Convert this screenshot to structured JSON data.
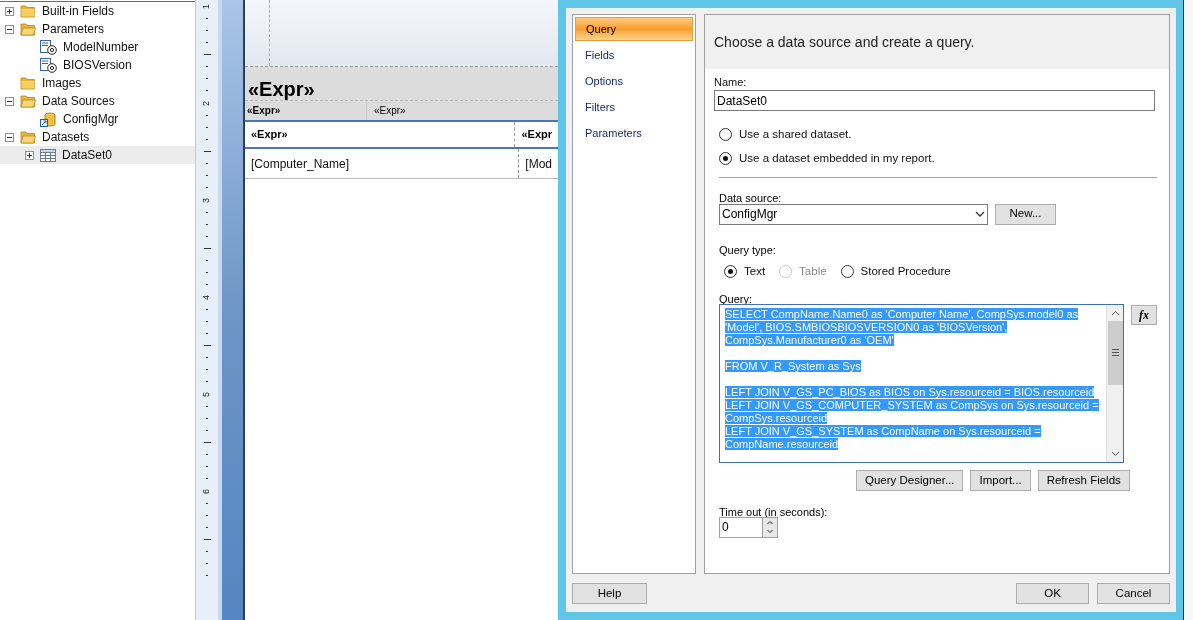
{
  "tree": [
    {
      "label": "Built-in Fields",
      "kind": "folder",
      "expanded": false,
      "selected": false
    },
    {
      "label": "Parameters",
      "kind": "folder",
      "expanded": true,
      "selected": false,
      "children": [
        {
          "label": "ModelNumber",
          "kind": "parameter",
          "selected": false
        },
        {
          "label": "BIOSVersion",
          "kind": "parameter",
          "selected": false
        }
      ]
    },
    {
      "label": "Images",
      "kind": "folder",
      "selected": false
    },
    {
      "label": "Data Sources",
      "kind": "folder",
      "expanded": true,
      "selected": false,
      "children": [
        {
          "label": "ConfigMgr",
          "kind": "data_source",
          "selected": false
        }
      ]
    },
    {
      "label": "Datasets",
      "kind": "folder",
      "expanded": true,
      "selected": false,
      "children": [
        {
          "label": "DataSet0",
          "kind": "dataset",
          "expanded": false,
          "selected": true
        }
      ]
    }
  ],
  "ruler": {
    "labels": [
      "1",
      "2",
      "3",
      "4",
      "5",
      "6"
    ]
  },
  "report": {
    "title": "«Expr»",
    "header_fields": [
      "«Expr»",
      "«Expr»"
    ],
    "columns": [
      "«Expr»",
      "«Expr"
    ],
    "row": [
      "[Computer_Name]",
      "[Mod"
    ]
  },
  "dialog": {
    "nav": [
      {
        "label": "Query",
        "selected": true
      },
      {
        "label": "Fields",
        "selected": false
      },
      {
        "label": "Options",
        "selected": false
      },
      {
        "label": "Filters",
        "selected": false
      },
      {
        "label": "Parameters",
        "selected": false
      }
    ],
    "heading": "Choose a data source and create a query.",
    "name_label": "Name:",
    "name_value": "DataSet0",
    "dataset_options": [
      {
        "label": "Use a shared dataset.",
        "selected": false
      },
      {
        "label": "Use a dataset embedded in my report.",
        "selected": true
      }
    ],
    "data_source_label": "Data source:",
    "data_source_value": "ConfigMgr",
    "new_button": "New...",
    "query_type_label": "Query type:",
    "query_types": [
      {
        "label": "Text",
        "selected": true,
        "disabled": false
      },
      {
        "label": "Table",
        "selected": false,
        "disabled": true
      },
      {
        "label": "Stored Procedure",
        "selected": false,
        "disabled": false
      }
    ],
    "query_label": "Query:",
    "query_text_selected": true,
    "query_paragraphs": [
      [
        "SELECT CompName.Name0 as 'Computer Name', CompSys.model0 as",
        "'Model', BIOS.SMBIOSBIOSVERSION0 as 'BIOSVersion',",
        "CompSys.Manufacturer0 as 'OEM'"
      ],
      [
        "FROM V_R_System as Sys"
      ],
      [
        "LEFT JOIN V_GS_PC_BIOS as BIOS on Sys.resourceid = BIOS.resourceid",
        "LEFT JOIN V_GS_COMPUTER_SYSTEM as CompSys on Sys.resourceid =",
        "CompSys.resourceid",
        "LEFT JOIN V_GS_SYSTEM as CompName on Sys.resourceid =",
        "CompName.resourceid"
      ]
    ],
    "expression_button": "fx",
    "query_buttons": [
      "Query Designer...",
      "Import...",
      "Refresh Fields"
    ],
    "timeout_label": "Time out (in seconds):",
    "timeout_value": "0",
    "help_button": "Help",
    "ok_button": "OK",
    "cancel_button": "Cancel"
  }
}
